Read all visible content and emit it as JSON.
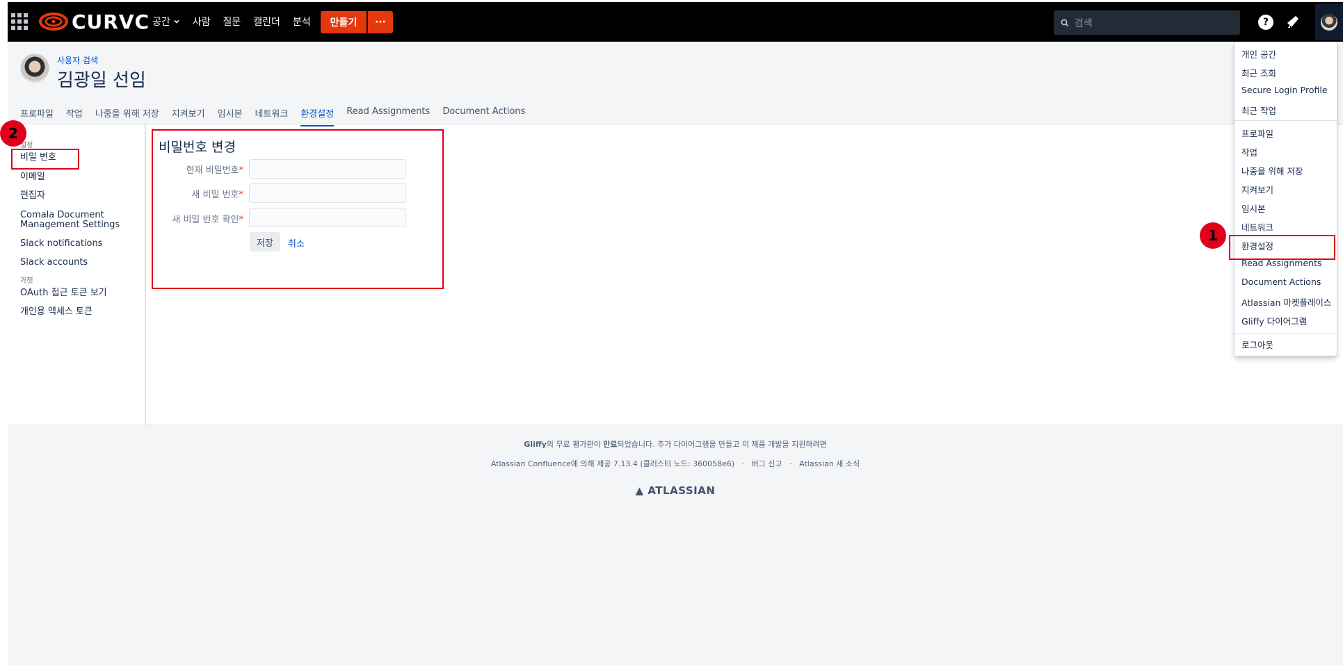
{
  "topnav": {
    "logo_text": "CURVC",
    "links": [
      {
        "label": "공간",
        "has_dropdown": true
      },
      {
        "label": "사람"
      },
      {
        "label": "질문"
      },
      {
        "label": "캘린더"
      },
      {
        "label": "분석"
      }
    ],
    "create_label": "만들기",
    "more_label": "···",
    "search_placeholder": "검색",
    "help_label": "?",
    "accent_color": "#e5380d"
  },
  "header": {
    "breadcrumb": "사용자 검색",
    "title": "김광일 선임",
    "tabs": [
      {
        "label": "프로파일"
      },
      {
        "label": "작업"
      },
      {
        "label": "나중을 위해 저장"
      },
      {
        "label": "지켜보기"
      },
      {
        "label": "임시본"
      },
      {
        "label": "네트워크"
      },
      {
        "label": "환경설정",
        "active": true
      },
      {
        "label": "Read Assignments"
      },
      {
        "label": "Document Actions"
      }
    ]
  },
  "sidebar": {
    "heading1": "설정",
    "items": [
      {
        "label": "비밀 번호"
      },
      {
        "label": "이메일"
      },
      {
        "label": "편집자"
      },
      {
        "label": "Comala Document Management Settings"
      },
      {
        "label": "Slack notifications"
      },
      {
        "label": "Slack accounts"
      }
    ],
    "heading2": "가젯",
    "items2": [
      {
        "label": "OAuth 접근 토큰 보기"
      },
      {
        "label": "개인용 액세스 토큰"
      }
    ]
  },
  "form": {
    "title": "비밀번호 변경",
    "current_label": "현재 비밀번호",
    "new_label": "새 비밀 번호",
    "confirm_label": "새 비밀 번호 확인",
    "required_mark": "*",
    "save_label": "저장",
    "cancel_label": "취소"
  },
  "footer": {
    "gliffy_brand": "Gliffy",
    "gliffy_notice_1": "의 무료 평가판이 ",
    "gliffy_expired": "만료",
    "gliffy_notice_2": "되었습니다. 추가 다이어그램을 만들고 이 제품 개발을 지원하려면",
    "powered_by": "Atlassian Confluence에 의해 제공 7.13.4 (클러스터 노드: 360058e6)",
    "sep": "·",
    "bug_report": "버그 신고",
    "news": "Atlassian 새 소식",
    "logo": "ATLASSIAN"
  },
  "user_menu": {
    "items": [
      {
        "label": "개인 공간"
      },
      {
        "label": "최근 조회"
      },
      {
        "label": "Secure Login Profile"
      },
      {
        "label": "최근 작업"
      },
      {
        "label": "프로파일"
      },
      {
        "label": "작업"
      },
      {
        "label": "나중을 위해 저장"
      },
      {
        "label": "지켜보기"
      },
      {
        "label": "임시본"
      },
      {
        "label": "네트워크"
      },
      {
        "label": "환경설정"
      },
      {
        "label": "Read Assignments"
      },
      {
        "label": "Document Actions"
      },
      {
        "label": "Atlassian 마켓플레이스"
      },
      {
        "label": "Gliffy 다이어그램"
      },
      {
        "label": "로그아웃"
      }
    ]
  },
  "annotations": {
    "badge1": "1",
    "badge2": "2",
    "highlight_color": "#e0001a"
  }
}
